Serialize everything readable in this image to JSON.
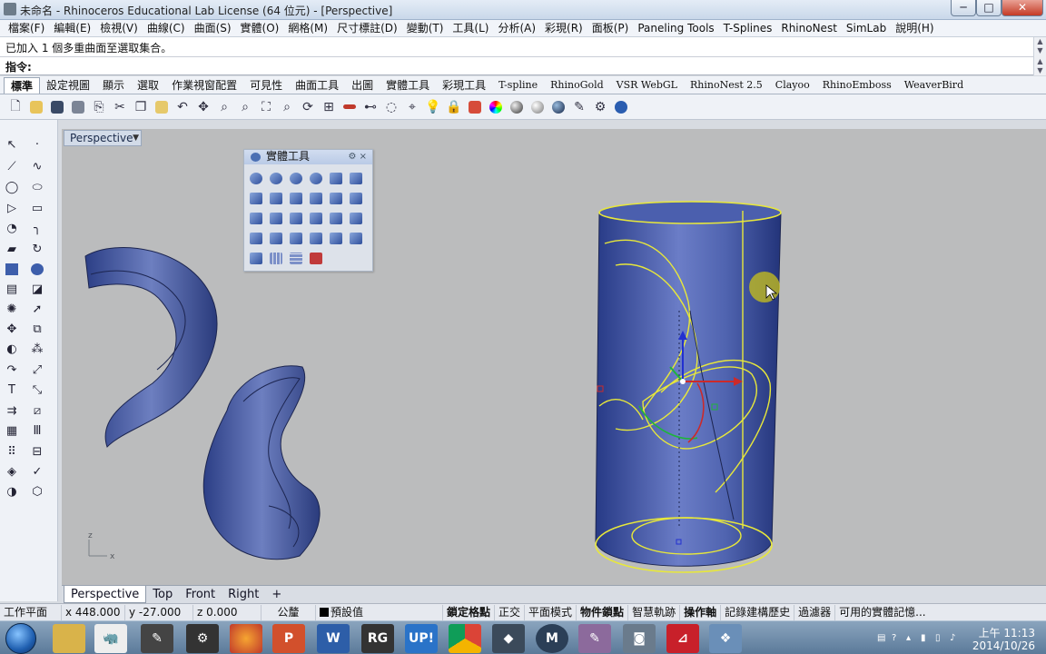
{
  "window": {
    "title": "未命名 - Rhinoceros Educational Lab License (64 位元) - [Perspective]",
    "min_label": "─",
    "max_label": "□",
    "close_label": "✕"
  },
  "menu": [
    "檔案(F)",
    "編輯(E)",
    "檢視(V)",
    "曲線(C)",
    "曲面(S)",
    "實體(O)",
    "網格(M)",
    "尺寸標註(D)",
    "變動(T)",
    "工具(L)",
    "分析(A)",
    "彩現(R)",
    "面板(P)",
    "Paneling Tools",
    "T-Splines",
    "RhinoNest",
    "SimLab",
    "說明(H)"
  ],
  "command": {
    "history": "已加入 1 個多重曲面至選取集合。",
    "prompt": "指令:",
    "value": ""
  },
  "toolbar_tabs": [
    "標準",
    "設定視圖",
    "顯示",
    "選取",
    "作業視窗配置",
    "可見性",
    "曲面工具",
    "出圖",
    "實體工具",
    "彩現工具",
    "T-spline",
    "RhinoGold",
    "VSR WebGL",
    "RhinoNest 2.5",
    "Clayoo",
    "RhinoEmboss",
    "WeaverBird"
  ],
  "toolbar_icons": [
    "new-file-icon",
    "open-folder-icon",
    "save-icon",
    "print-icon",
    "import-icon",
    "cut-icon",
    "copy-icon",
    "paste-icon",
    "undo-icon",
    "pan-icon",
    "zoom-icon",
    "zoom-window-icon",
    "zoom-extents-icon",
    "zoom-selected-icon",
    "rotate-view-icon",
    "viewport-layout-icon",
    "cplane-icon",
    "named-view-icon",
    "grid-snap-icon",
    "osnap-icon",
    "light-icon",
    "lock-icon",
    "layer-icon",
    "color-wheel-icon",
    "render-sphere-icon",
    "shaded-sphere-icon",
    "ghosted-sphere-icon",
    "properties-icon",
    "filter-icon",
    "help-icon"
  ],
  "viewport": {
    "label": "Perspective",
    "axis_z": "z",
    "axis_x": "x"
  },
  "panel": {
    "title": "實體工具",
    "gear": "⚙",
    "close": "×",
    "icon_count": 26
  },
  "view_tabs": [
    "Perspective",
    "Top",
    "Front",
    "Right"
  ],
  "add_tab": "+",
  "status": {
    "cplane": "工作平面",
    "x": "x 448.000",
    "y": "y -27.000",
    "z": "z 0.000",
    "unit": "公釐",
    "layer": "預設值",
    "grid_snap": "鎖定格點",
    "ortho": "正交",
    "planar": "平面模式",
    "osnap": "物件鎖點",
    "smart_track": "智慧軌跡",
    "gumball": "操作軸",
    "history": "記錄建構歷史",
    "filter": "過濾器",
    "memory": "可用的實體記憶..."
  },
  "taskbar": {
    "time": "上午 11:13",
    "date": "2014/10/26",
    "rg": "RG",
    "up": "UP!",
    "word": "W"
  }
}
